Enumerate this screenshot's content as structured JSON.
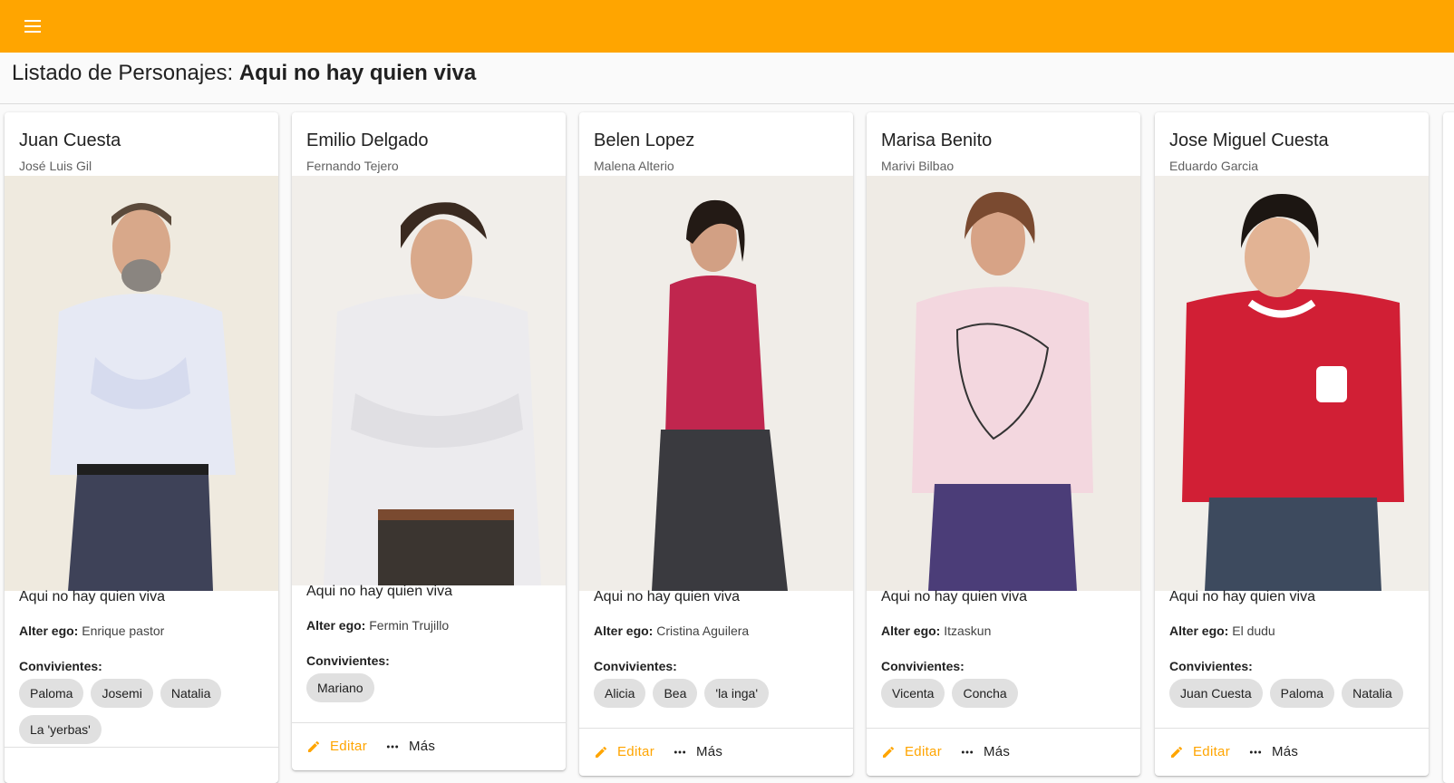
{
  "header": {
    "menu_icon": "menu-icon",
    "toolbar_color": "#ffa500"
  },
  "page": {
    "title_prefix": "Listado de Personajes: ",
    "title_series": "Aqui no hay quien viva"
  },
  "labels": {
    "alter_ego": "Alter ego:",
    "convivientes": "Convivientes:",
    "edit": "Editar",
    "more": "Más"
  },
  "characters": [
    {
      "name": "Juan Cuesta",
      "actor": "José Luis Gil",
      "series": "Aqui no hay quien viva",
      "alter_ego": "Enrique pastor",
      "convivientes": [
        "Paloma",
        "Josemi",
        "Natalia",
        "La 'yerbas'"
      ]
    },
    {
      "name": "Emilio Delgado",
      "actor": "Fernando Tejero",
      "series": "Aqui no hay quien viva",
      "alter_ego": "Fermin Trujillo",
      "convivientes": [
        "Mariano"
      ]
    },
    {
      "name": "Belen Lopez",
      "actor": "Malena Alterio",
      "series": "Aqui no hay quien viva",
      "alter_ego": "Cristina Aguilera",
      "convivientes": [
        "Alicia",
        "Bea",
        "'la inga'"
      ]
    },
    {
      "name": "Marisa Benito",
      "actor": "Marivi Bilbao",
      "series": "Aqui no hay quien viva",
      "alter_ego": "Itzaskun",
      "convivientes": [
        "Vicenta",
        "Concha"
      ]
    },
    {
      "name": "Jose Miguel Cuesta",
      "actor": "Eduardo Garcia",
      "series": "Aqui no hay quien viva",
      "alter_ego": "El dudu",
      "convivientes": [
        "Juan Cuesta",
        "Paloma",
        "Natalia"
      ]
    }
  ]
}
